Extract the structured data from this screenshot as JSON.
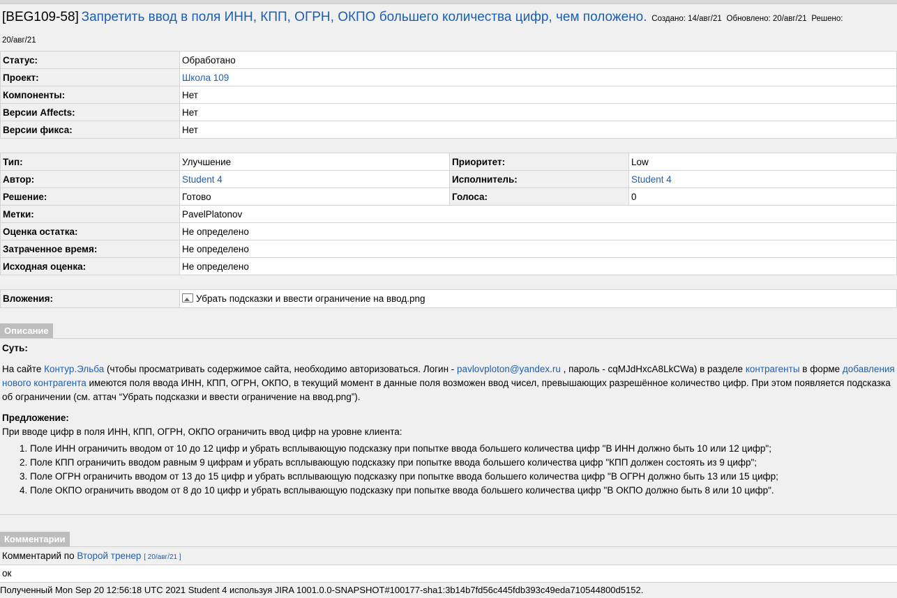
{
  "issue": {
    "key": "[BEG109-58]",
    "summary": "Запретить ввод в поля ИНН, КПП, ОГРН, ОКПО большего количества цифр, чем положено.",
    "created": "Создано: 14/авг/21",
    "updated": "Обновлено: 20/авг/21",
    "resolved_label": "Решено:",
    "resolved_date": "20/авг/21"
  },
  "fields1": [
    {
      "label": "Статус:",
      "value": "Обработано"
    },
    {
      "label": "Проект:",
      "value": "Школа 109"
    },
    {
      "label": "Компоненты:",
      "value": "Нет"
    },
    {
      "label": "Версии Affects:",
      "value": "Нет"
    },
    {
      "label": "Версии фикса:",
      "value": "Нет"
    }
  ],
  "fields2": {
    "type_label": "Тип:",
    "type_value": "Улучшение",
    "priority_label": "Приоритет:",
    "priority_value": "Low",
    "author_label": "Автор:",
    "author_value": "Student 4",
    "assignee_label": "Исполнитель:",
    "assignee_value": "Student 4",
    "resolution_label": "Решение:",
    "resolution_value": "Готово",
    "votes_label": "Голоса:",
    "votes_value": "0",
    "labels_label": "Метки:",
    "labels_value": "PavelPlatonov",
    "remaining_label": "Оценка остатка:",
    "remaining_value": "Не определено",
    "spent_label": "Затраченное время:",
    "spent_value": "Не определено",
    "original_label": "Исходная оценка:",
    "original_value": "Не определено"
  },
  "attachments": {
    "label": "Вложения:",
    "file": "Убрать подсказки и ввести ограничение на ввод.png",
    "icon": "image-icon"
  },
  "description": {
    "heading": "Описание",
    "essence_title": "Суть:",
    "p1_a": "На сайте ",
    "p1_link1": "Контур.Эльба",
    "p1_b": " (чтобы просматривать содержимое сайта, необходимо авторизоваться. Логин - ",
    "p1_email": "pavlovploton@yandex.ru",
    "p1_c": " , пароль - cqMJdHxcA8LkCWa) в разделе ",
    "p1_link2": "контрагенты",
    "p1_d": " в форме ",
    "p1_link3": "добавления нового контрагента",
    "p1_e": " имеются поля ввода ИНН, КПП, ОГРН, ОКПО, в текущий момент в данные поля возможен ввод чисел, превышающих разрешённое количество цифр. При этом появляется подсказка об ограничении (см. аттач “Убрать подсказки и ввести ограничение на ввод.png”).",
    "proposal_title": "Предложение:",
    "proposal_intro": "При вводе цифр в поля ИНН, КПП, ОГРН, ОКПО ограничить ввод цифр на уровне клиента:",
    "items": [
      "Поле ИНН ограничить вводом от 10 до 12 цифр и убрать всплывающую подсказку при попытке ввода большего количества цифр \"В ИНН должно быть 10 или 12 цифр\";",
      "Поле КПП ограничить вводом равным 9 цифрам и убрать всплывающую подсказку при попытке ввода большего количества цифр \"КПП должен состоять из 9 цифр\";",
      "Поле ОГРН ограничить вводом от 13 до 15 цифр и убрать всплывающую подсказку при попытке ввода большего количества цифр \"В ОГРН должно быть 13 или 15 цифр;",
      "Поле ОКПО ограничить вводом от 8 до 10 цифр и убрать всплывающую подсказку при попытке ввода большего количества цифр \"В ОКПО должно быть 8 или 10 цифр\"."
    ]
  },
  "comments": {
    "heading": "Комментарии",
    "prefix": "Комментарий по ",
    "author": "Второй тренер",
    "date": "[ 20/авг/21 ]",
    "body": "ок"
  },
  "footer": "Полученный Mon Sep 20 12:56:18 UTC 2021 Student 4 используя JIRA 1001.0.0-SNAPSHOT#100177-sha1:3b14b7fd56c445fdb393c49eda710544800d5152."
}
